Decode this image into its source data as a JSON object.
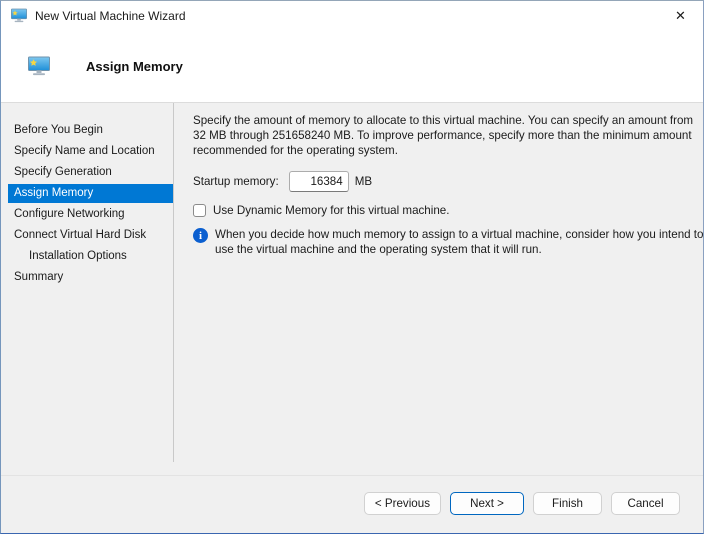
{
  "window": {
    "title": "New Virtual Machine Wizard"
  },
  "icons": {
    "close": "✕",
    "info": "i"
  },
  "header": {
    "title": "Assign Memory"
  },
  "sidebar": {
    "items": [
      {
        "label": "Before You Begin",
        "active": false,
        "indent": false
      },
      {
        "label": "Specify Name and Location",
        "active": false,
        "indent": false
      },
      {
        "label": "Specify Generation",
        "active": false,
        "indent": false
      },
      {
        "label": "Assign Memory",
        "active": true,
        "indent": false
      },
      {
        "label": "Configure Networking",
        "active": false,
        "indent": false
      },
      {
        "label": "Connect Virtual Hard Disk",
        "active": false,
        "indent": false
      },
      {
        "label": "Installation Options",
        "active": false,
        "indent": true
      },
      {
        "label": "Summary",
        "active": false,
        "indent": false
      }
    ]
  },
  "main": {
    "description": "Specify the amount of memory to allocate to this virtual machine. You can specify an amount from 32 MB through 251658240 MB. To improve performance, specify more than the minimum amount recommended for the operating system.",
    "startup_memory": {
      "label": "Startup memory:",
      "value": "16384",
      "unit": "MB"
    },
    "dynamic_memory": {
      "label": "Use Dynamic Memory for this virtual machine.",
      "checked": false
    },
    "info_note": "When you decide how much memory to assign to a virtual machine, consider how you intend to use the virtual machine and the operating system that it will run."
  },
  "footer": {
    "buttons": [
      {
        "label": "< Previous",
        "default": false
      },
      {
        "label": "Next >",
        "default": true
      },
      {
        "label": "Finish",
        "default": false
      },
      {
        "label": "Cancel",
        "default": false
      }
    ]
  },
  "colors": {
    "accent": "#0078D4",
    "next_button_border": "#0067C0",
    "info_icon": "#0B5FD0",
    "body_bg": "#F0F0F0"
  }
}
